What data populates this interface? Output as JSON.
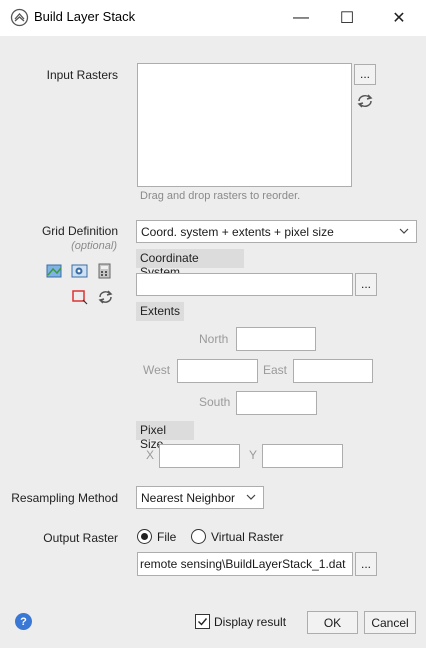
{
  "window": {
    "title": "Build Layer Stack",
    "minimize_symbol": "—",
    "maximize_symbol": "☐",
    "close_symbol": "✕"
  },
  "input_rasters": {
    "label": "Input Rasters",
    "browse_label": "...",
    "hint": "Drag and drop rasters to reorder."
  },
  "grid_definition": {
    "label": "Grid Definition",
    "optional_label": "(optional)",
    "selected": "Coord. system + extents + pixel size",
    "coordinate_system_header": "Coordinate System",
    "coordinate_system_value": "",
    "browse_label": "...",
    "extents_header": "Extents",
    "north_label": "North",
    "west_label": "West",
    "east_label": "East",
    "south_label": "South",
    "pixel_size_header": "Pixel Size",
    "x_label": "X",
    "y_label": "Y"
  },
  "resampling": {
    "label": "Resampling Method",
    "selected": "Nearest Neighbor"
  },
  "output": {
    "label": "Output Raster",
    "file_option": "File",
    "virtual_option": "Virtual Raster",
    "selected": "File",
    "path": "remote sensing\\BuildLayerStack_1.dat",
    "browse_label": "..."
  },
  "footer": {
    "display_result_label": "Display result",
    "display_result_checked": true,
    "ok_label": "OK",
    "cancel_label": "Cancel",
    "help_symbol": "?"
  },
  "colors": {
    "dialog_bg": "#ededed",
    "help_blue": "#3a78d6"
  }
}
